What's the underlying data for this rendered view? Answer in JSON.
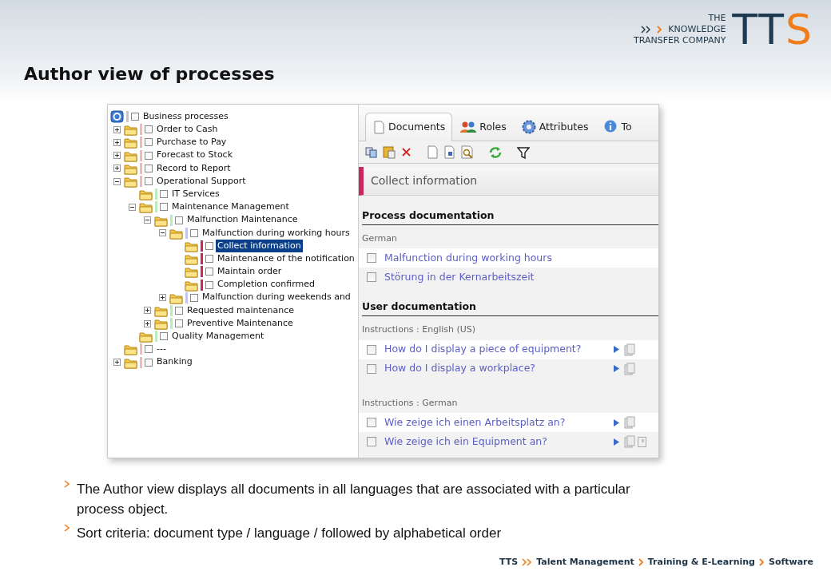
{
  "logo": {
    "lines": [
      "THE",
      "KNOWLEDGE",
      "TRANSFER COMPANY"
    ],
    "mark": "TTS"
  },
  "title": "Author view of processes",
  "tree": {
    "label": "Business processes",
    "kind": "root",
    "color": "#c8c8c8",
    "checked": false,
    "selected": false,
    "children": [
      {
        "label": "Order to Cash",
        "expanded": false,
        "color": "#f4b8b8",
        "checked": false,
        "selected": false
      },
      {
        "label": "Purchase to Pay",
        "expanded": false,
        "color": "#f4b8b8",
        "checked": false,
        "selected": false
      },
      {
        "label": "Forecast to Stock",
        "expanded": false,
        "color": "#f4b8b8",
        "checked": false,
        "selected": false
      },
      {
        "label": "Record to Report",
        "expanded": false,
        "color": "#f4b8b8",
        "checked": false,
        "selected": false
      },
      {
        "label": "Operational Support",
        "expanded": true,
        "color": "#f4b8b8",
        "checked": false,
        "selected": false,
        "children": [
          {
            "label": "IT Services",
            "color": "#b8ecb8",
            "checked": false,
            "selected": false
          },
          {
            "label": "Maintenance Management",
            "expanded": true,
            "color": "#b8ecb8",
            "checked": false,
            "selected": false,
            "children": [
              {
                "label": "Malfunction Maintenance",
                "expanded": true,
                "color": "#b8ecb8",
                "checked": false,
                "selected": false,
                "children": [
                  {
                    "label": "Malfunction during working hours",
                    "expanded": true,
                    "color": "#c4c4f2",
                    "checked": false,
                    "selected": false,
                    "children": [
                      {
                        "label": "Collect information",
                        "color": "#c8285a",
                        "checked": false,
                        "selected": true
                      },
                      {
                        "label": "Maintenance of the notification",
                        "color": "#c8285a",
                        "checked": false,
                        "selected": false
                      },
                      {
                        "label": "Maintain order",
                        "color": "#c8285a",
                        "checked": false,
                        "selected": false
                      },
                      {
                        "label": "Completion confirmed",
                        "color": "#c8285a",
                        "checked": false,
                        "selected": false
                      }
                    ]
                  },
                  {
                    "label": "Malfunction during weekends and",
                    "expanded": false,
                    "color": "#c4c4f2",
                    "checked": false,
                    "selected": false
                  }
                ]
              },
              {
                "label": "Requested maintenance",
                "expanded": false,
                "color": "#b8ecb8",
                "checked": false,
                "selected": false
              },
              {
                "label": "Preventive Maintenance",
                "expanded": false,
                "color": "#b8ecb8",
                "checked": false,
                "selected": false
              }
            ]
          },
          {
            "label": "Quality Management",
            "color": "#b8ecb8",
            "checked": false,
            "selected": false
          }
        ]
      },
      {
        "label": "---",
        "color": "#f4b8b8",
        "checked": false,
        "selected": false
      },
      {
        "label": "Banking",
        "expanded": false,
        "color": "#f4b8b8",
        "checked": false,
        "selected": false
      }
    ]
  },
  "tabs": [
    {
      "label": "Documents",
      "kind": "documents",
      "selected": true
    },
    {
      "label": "Roles",
      "kind": "roles",
      "selected": false
    },
    {
      "label": "Attributes",
      "kind": "attributes",
      "selected": false
    },
    {
      "label": "To",
      "kind": "info",
      "selected": false
    }
  ],
  "object_title": "Collect information",
  "sections": [
    {
      "title": "Process documentation",
      "groups": [
        {
          "label": "German",
          "items": [
            {
              "text": "Malfunction during working hours",
              "kind": "plain",
              "checked": false
            },
            {
              "text": "Störung in der Kernarbeitszeit",
              "kind": "plain",
              "checked": false
            }
          ]
        }
      ]
    },
    {
      "title": "User documentation",
      "groups": [
        {
          "label": "Instructions : English (US)",
          "items": [
            {
              "text": "How do I display a piece of equipment?",
              "kind": "files",
              "checked": false
            },
            {
              "text": "How do I display a workplace?",
              "kind": "files",
              "checked": false
            }
          ]
        },
        {
          "label": "Instructions : German",
          "items": [
            {
              "text": "Wie zeige ich einen Arbeitsplatz an?",
              "kind": "files",
              "checked": false
            },
            {
              "text": "Wie zeige ich ein Equipment an?",
              "kind": "files-page",
              "checked": false
            }
          ]
        }
      ]
    }
  ],
  "bullets": [
    "The Author view displays all documents in all languages that are associated with a particular process object.",
    "Sort criteria: document type / language / followed by alphabetical order"
  ],
  "footer": [
    "TTS",
    "Talent Management",
    "Training & E-Learning",
    "Software"
  ]
}
